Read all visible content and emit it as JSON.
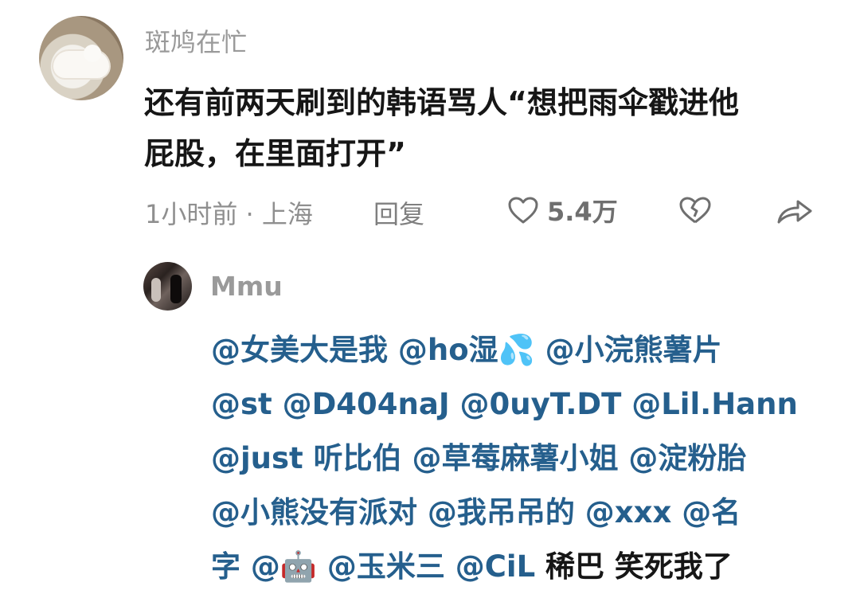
{
  "comment": {
    "username": "斑鸠在忙",
    "text_line1": "还有前两天刷到的韩语骂人“想把雨伞戳进他",
    "text_line2": "屁股，在里面打开”",
    "time_location": "1小时前 · 上海",
    "reply_label": "回复",
    "likes": "5.4万",
    "icons": {
      "like": "heart-outline-icon",
      "dislike": "broken-heart-icon",
      "share": "share-arrow-icon"
    }
  },
  "reply": {
    "username": "Mmu",
    "line1": "@女美大是我 @ho湿",
    "emoji_drops": "💦",
    "line1_tail": " @小浣熊薯片",
    "line2": "@st @D404naJ @0uyT.DT @Lil.Hann",
    "line3": "@just 听比伯 @草莓麻薯小姐 @淀粉胎",
    "line4": "@小熊没有派对 @我吊吊的 @xxx @名",
    "line5_start": "字 @",
    "emoji_robot": "🤖",
    "line5_mentions": " @玉米三 @CiL",
    "line5_plain": " 稀巴 笑死我了"
  },
  "colors": {
    "mention": "#255f8d",
    "text": "#161616",
    "meta": "#8f8f8f"
  }
}
